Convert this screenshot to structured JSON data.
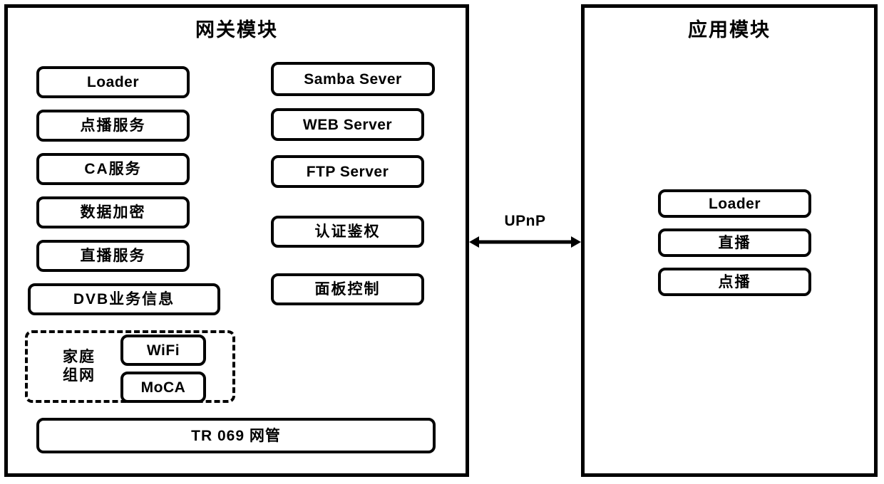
{
  "diagram": {
    "title_gateway": "网关模块",
    "title_application": "应用模块",
    "connector": {
      "label": "UPnP",
      "icon": "double-arrow-icon",
      "direction": "bidirectional"
    },
    "gateway": {
      "left_column": [
        {
          "label": "Loader"
        },
        {
          "label": "点播服务"
        },
        {
          "label": "CA服务"
        },
        {
          "label": "数据加密"
        },
        {
          "label": "直播服务"
        },
        {
          "label": "DVB业务信息"
        }
      ],
      "middle_column": [
        {
          "label": "Samba Sever"
        },
        {
          "label": "WEB Server"
        },
        {
          "label": "FTP Server"
        },
        {
          "label": "认证鉴权"
        },
        {
          "label": "面板控制"
        }
      ],
      "home_network_group": {
        "label": "家庭组网",
        "label_line1": "家庭",
        "label_line2": "组网",
        "members": [
          {
            "label": "WiFi"
          },
          {
            "label": "MoCA"
          }
        ]
      },
      "footer_box": {
        "label": "TR 069 网管"
      }
    },
    "application": {
      "items": [
        {
          "label": "Loader"
        },
        {
          "label": "直播"
        },
        {
          "label": "点播"
        }
      ]
    },
    "colors": {
      "stroke": "#000000",
      "fill": "#ffffff"
    }
  }
}
